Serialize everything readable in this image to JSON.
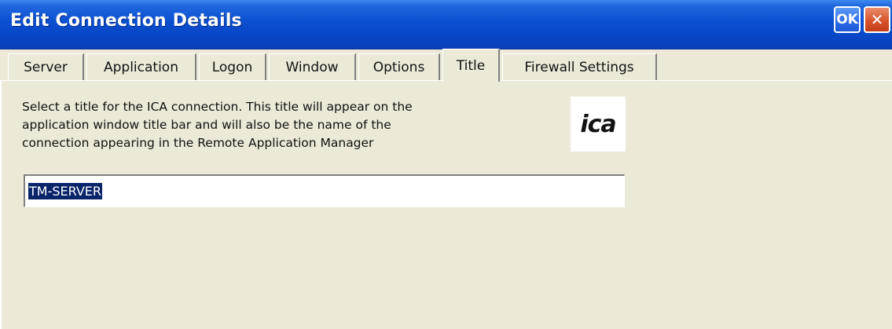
{
  "window": {
    "title": "Edit Connection Details",
    "ok_label": "OK",
    "close_label": "✕"
  },
  "tabs": [
    {
      "label": "Server",
      "active": false
    },
    {
      "label": "Application",
      "active": false
    },
    {
      "label": "Logon",
      "active": false
    },
    {
      "label": "Window",
      "active": false
    },
    {
      "label": "Options",
      "active": false
    },
    {
      "label": "Title",
      "active": true
    },
    {
      "label": "Firewall Settings",
      "active": false
    }
  ],
  "title_tab": {
    "description_lines": [
      "Select a title for the ICA connection.  This title will appear on the",
      "application window title bar and will also be the name of the",
      "connection appearing in the Remote Application Manager"
    ],
    "logo_text": "ica",
    "title_value": "TM-SERVER"
  },
  "colors": {
    "titlebar": "#0b4fd0",
    "background": "#ece9d8",
    "selection": "#0a246a"
  }
}
